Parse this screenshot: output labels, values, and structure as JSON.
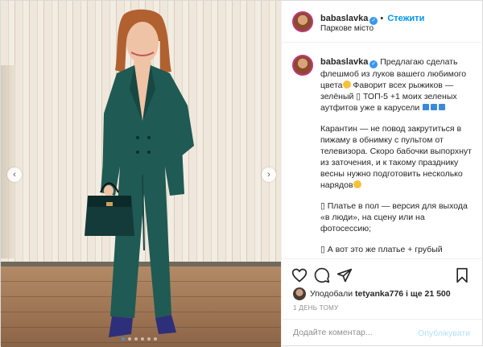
{
  "header": {
    "username": "babaslavka",
    "separator": "•",
    "follow_label": "Стежити",
    "location": "Паркове місто"
  },
  "caption": {
    "username": "babaslavka",
    "paragraph1_a": "Предлагаю сделать флешмоб из луков вашего любимого цвета",
    "paragraph1_b": " Фаворит всех рыжиков — зелёный ▯ ТОП-5 +1 моих зеленых аутфитов уже в карусели",
    "paragraph2": "Карантин — не повод закрутиться в пижаму в обнимку с пультом от телевизора. Скоро бабочки выпорхнут из заточения, и к такому празднику весны нужно подготовить несколько нарядов",
    "paragraph3": "▯ Платье в пол — версия для выхода «в люди», на сцену или на фотосессию;",
    "paragraph4": "▯ А вот это же платье + грубый мужской пиджак — обычный выход в ресторан"
  },
  "likes": {
    "prefix": "Уподобали",
    "user": "tetyanka776",
    "suffix": "і ще 21 500"
  },
  "timestamp": "1 ДЕНЬ ТОМУ",
  "comment": {
    "placeholder": "Додайте коментар...",
    "publish_label": "Опублікувати"
  },
  "carousel": {
    "prev_icon": "chevron-left-icon",
    "next_icon": "chevron-right-icon",
    "slide_count": 6,
    "active_slide": 1
  },
  "colors": {
    "accent": "#0095f6",
    "verified": "#3897f0",
    "publish_disabled": "#b2dffc",
    "suit": "#1f5a54"
  }
}
